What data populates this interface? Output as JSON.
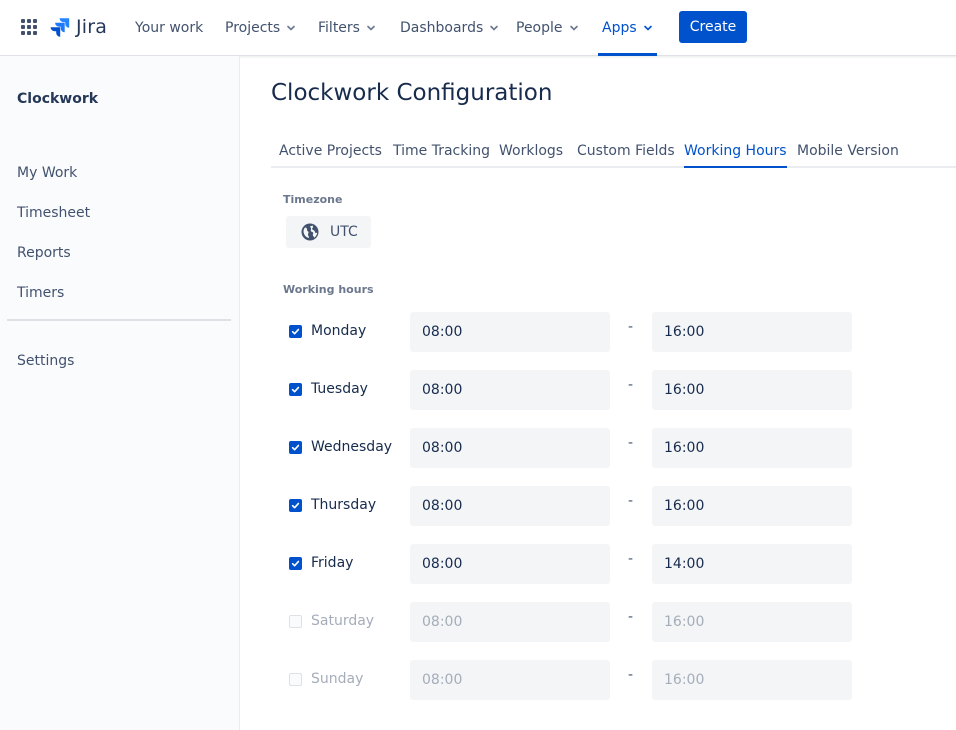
{
  "topnav": {
    "brand": "Jira",
    "items": [
      "Your work",
      "Projects",
      "Filters",
      "Dashboards",
      "People",
      "Apps"
    ],
    "active": "Apps",
    "create_label": "Create",
    "accent": "#0052cc"
  },
  "sidebar": {
    "title": "Clockwork",
    "items": [
      "My Work",
      "Timesheet",
      "Reports",
      "Timers"
    ],
    "settings": "Settings"
  },
  "main": {
    "title": "Clockwork Configuration",
    "tabs": [
      "Active Projects",
      "Time Tracking",
      "Worklogs",
      "Custom Fields",
      "Working Hours",
      "Mobile Version"
    ],
    "active_tab": "Working Hours",
    "timezone_label": "Timezone",
    "timezone_value": "UTC",
    "working_hours_label": "Working hours",
    "separator": "-",
    "days": [
      {
        "name": "Monday",
        "checked": true,
        "start": "08:00",
        "end": "16:00"
      },
      {
        "name": "Tuesday",
        "checked": true,
        "start": "08:00",
        "end": "16:00"
      },
      {
        "name": "Wednesday",
        "checked": true,
        "start": "08:00",
        "end": "16:00"
      },
      {
        "name": "Thursday",
        "checked": true,
        "start": "08:00",
        "end": "16:00"
      },
      {
        "name": "Friday",
        "checked": true,
        "start": "08:00",
        "end": "14:00"
      },
      {
        "name": "Saturday",
        "checked": false,
        "start": "08:00",
        "end": "16:00"
      },
      {
        "name": "Sunday",
        "checked": false,
        "start": "08:00",
        "end": "16:00"
      }
    ]
  },
  "icons": {
    "app_switcher": "app-switcher-grid-icon",
    "logo": "jira-logo-icon",
    "dropdown": "chevron-down-icon",
    "timezone": "globe-icon",
    "checkbox": "checkmark-icon"
  }
}
